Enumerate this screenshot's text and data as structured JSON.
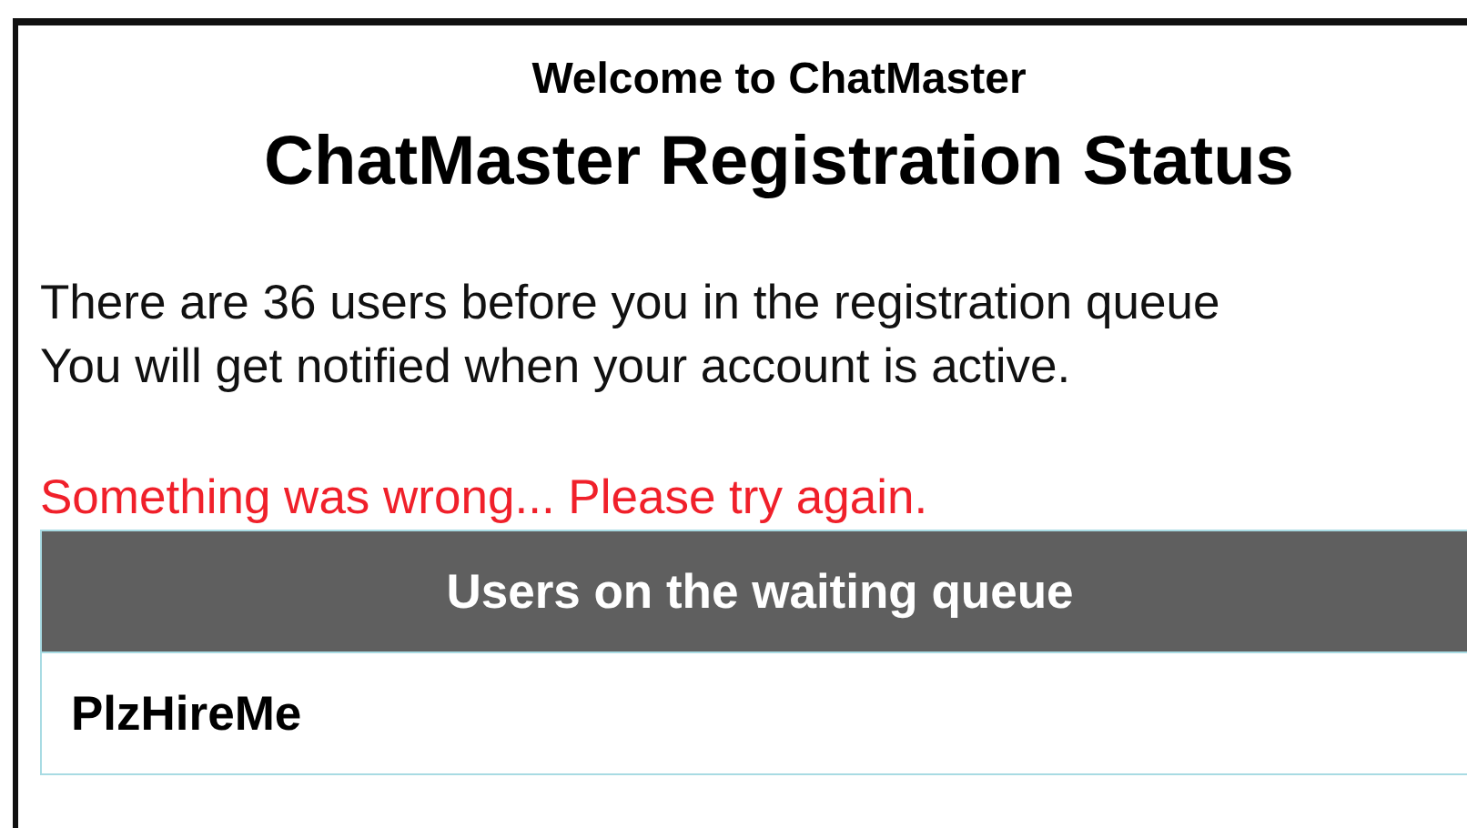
{
  "header": {
    "welcome": "Welcome to ChatMaster",
    "title": "ChatMaster Registration Status"
  },
  "message": [
    "There are 36 users before you in the registration queue",
    "You will get notified when your account is active."
  ],
  "error": "Something was wrong... Please try again.",
  "table": {
    "columns": [
      "Users on the waiting queue"
    ],
    "rows": [
      [
        "PlzHireMe"
      ]
    ]
  }
}
